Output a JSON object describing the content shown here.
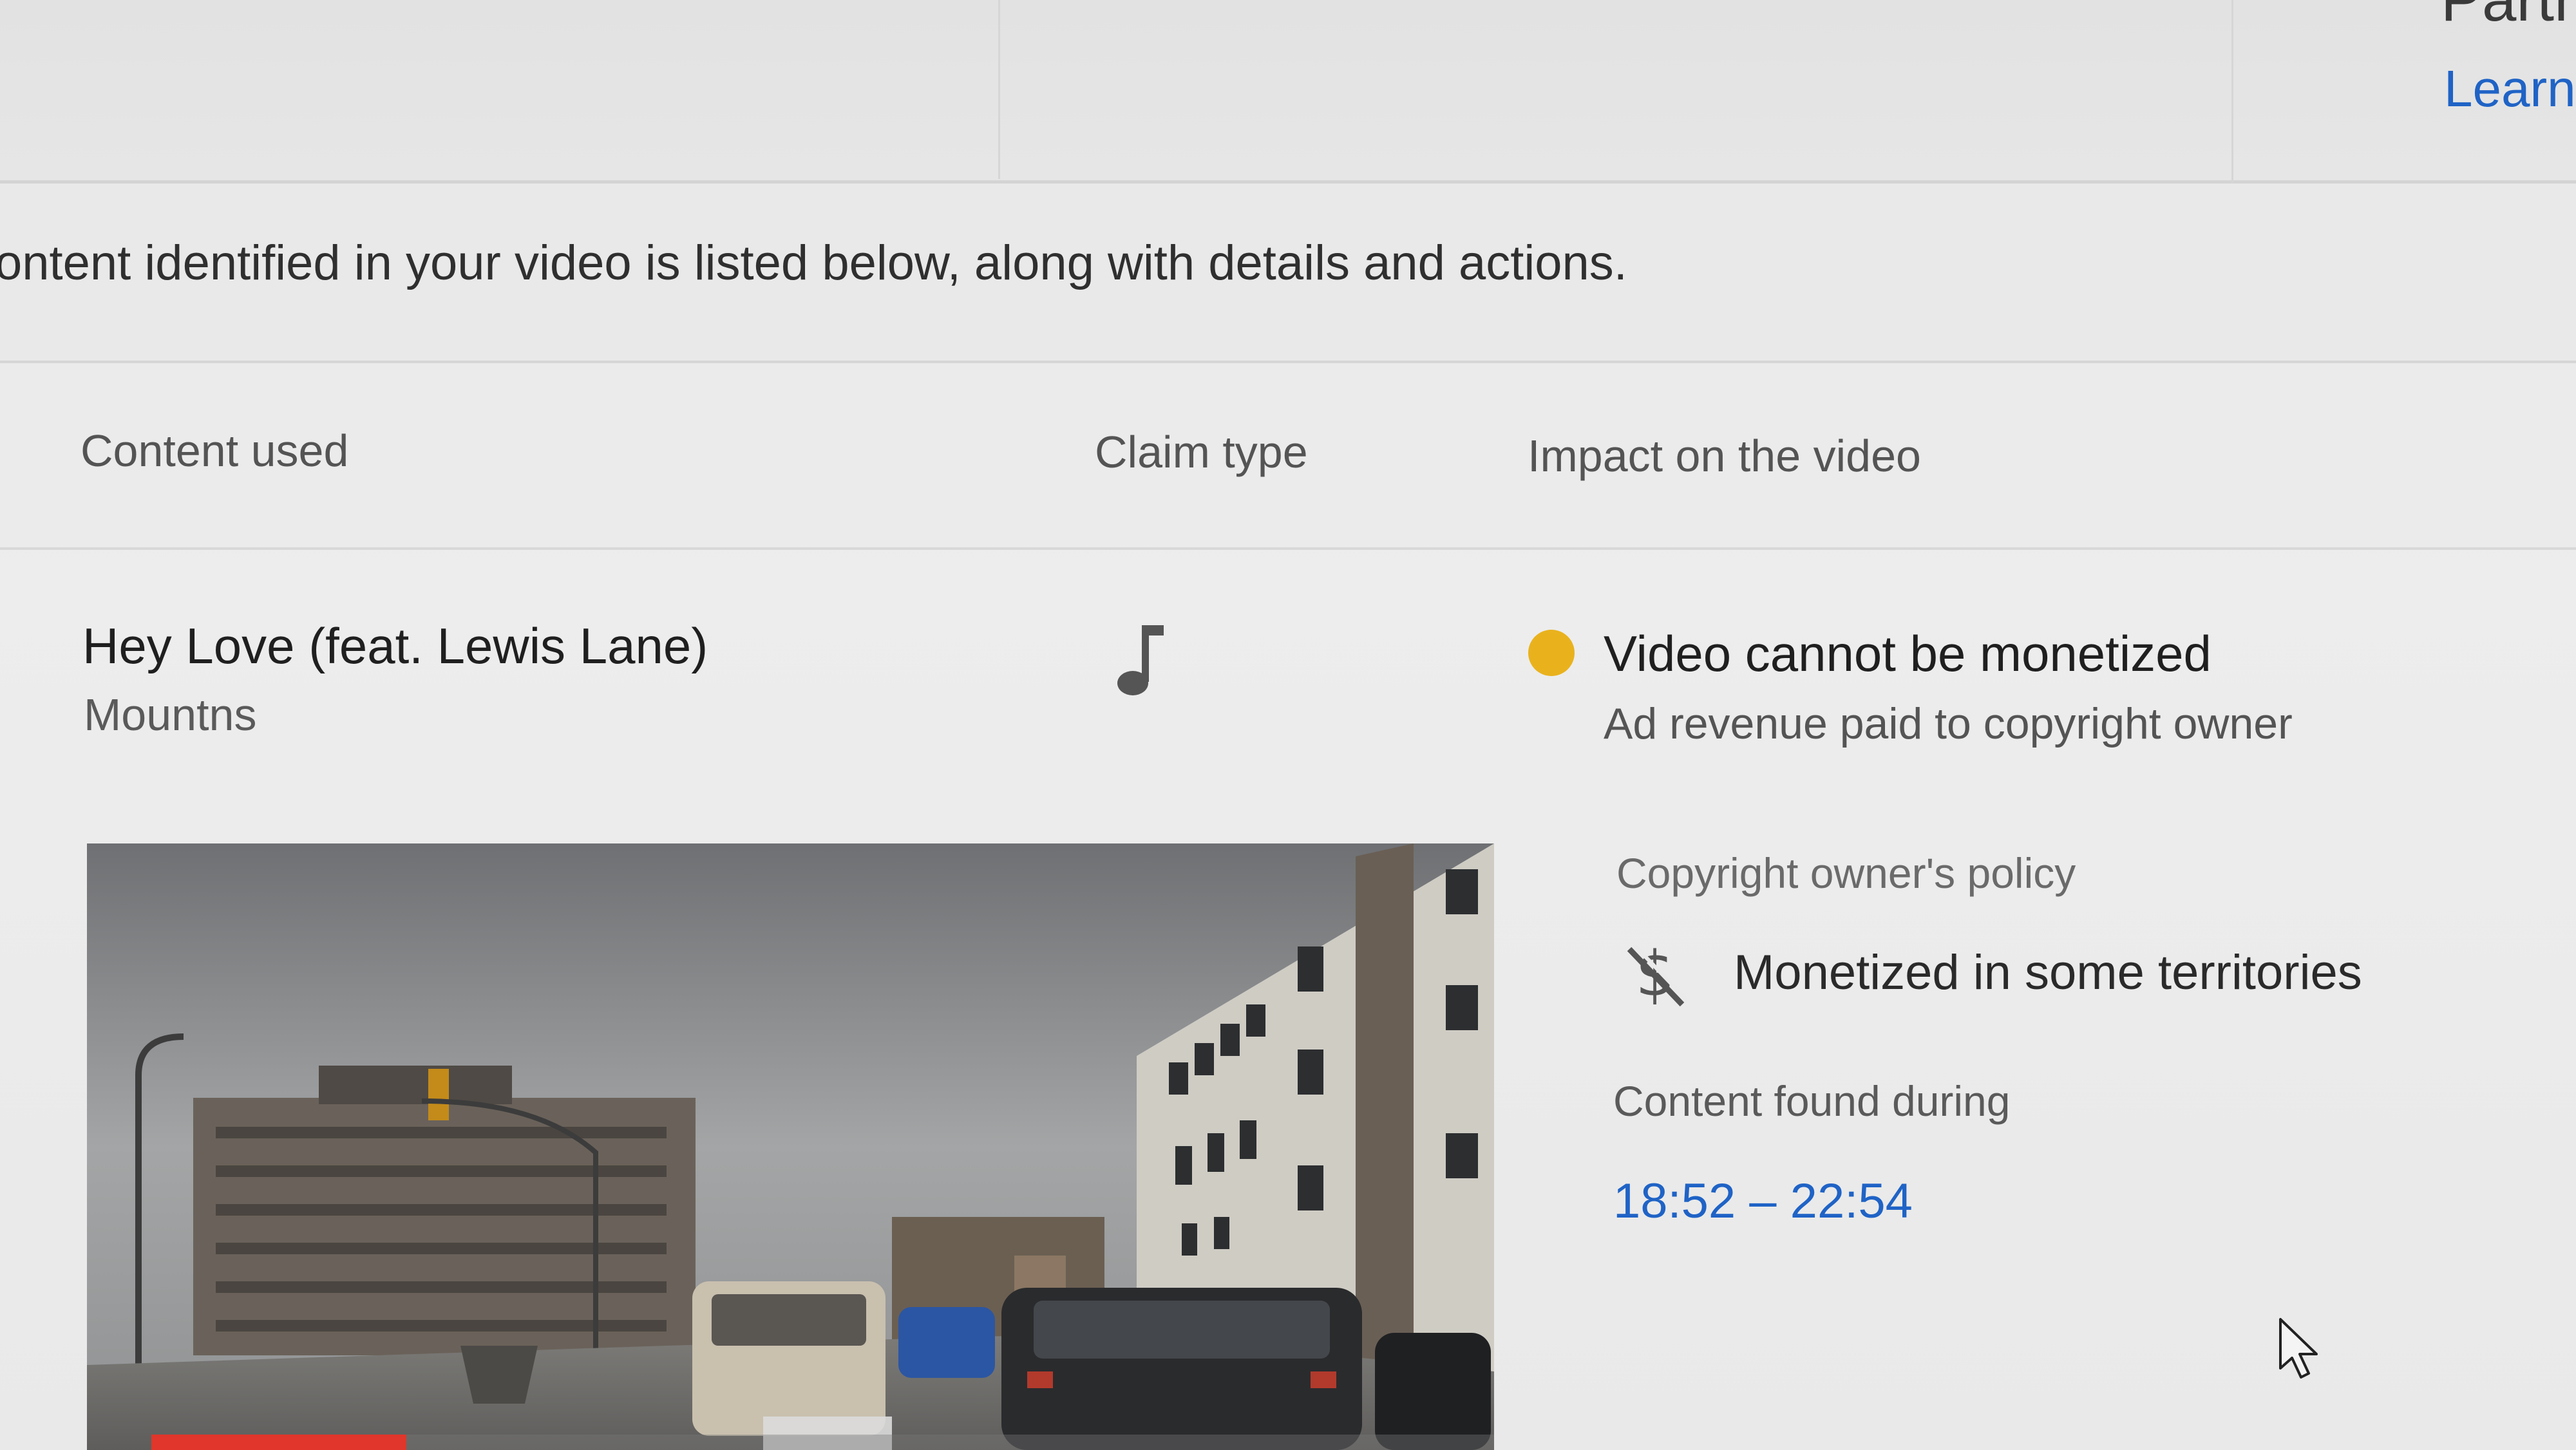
{
  "header": {
    "partner_text": "Partne",
    "learn_label": "Learn"
  },
  "intro": {
    "text": "ontent identified in your video is listed below, along with details and actions."
  },
  "table": {
    "columns": [
      "Content used",
      "Claim type",
      "Impact on the video"
    ]
  },
  "claim": {
    "title": "Hey Love (feat. Lewis Lane)",
    "artist": "Mountns",
    "claim_type_icon": "music-note-icon",
    "impact_title": "Video cannot be monetized",
    "impact_subtitle": "Ad revenue paid to copyright owner",
    "status_color": "#e9b21d"
  },
  "policy": {
    "label": "Copyright owner's policy",
    "icon": "no-dollar-icon",
    "value": "Monetized in some territories"
  },
  "found": {
    "label": "Content found during",
    "range": "18:52 – 22:54"
  },
  "video": {
    "progress_fraction": 0.19
  },
  "colors": {
    "link": "#1f63c6",
    "progress": "#e0362b"
  }
}
